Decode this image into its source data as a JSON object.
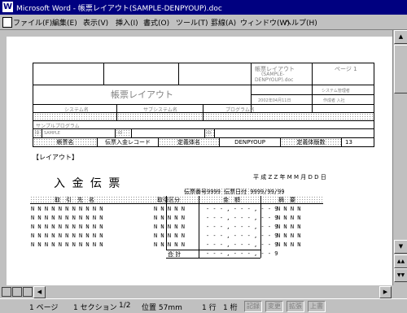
{
  "window": {
    "title": "Microsoft Word - 帳票レイアウト(SAMPLE-DENPYOUP).doc"
  },
  "menu": [
    "ファイル(F)",
    "編集(E)",
    "表示(V)",
    "挿入(I)",
    "書式(O)",
    "ツール(T)",
    "罫線(A)",
    "ウィンドウ(W)",
    "ヘルプ(H)"
  ],
  "header": {
    "title_small": "帳票レイアウト",
    "sub1": "(SAMPLE-",
    "sub2": "DENPYOUP).doc",
    "page_label": "ページ 1",
    "big_title": "帳票レイアウト",
    "sys_name": "システム名",
    "subsystem_name": "サブシステム名",
    "program_name": "プログラム名",
    "date_label": "2002年04月11日",
    "creator_label": "システム管理者",
    "author_label": "作成者 入社",
    "sample_program": "サンプルプログラム",
    "id_label": "ID",
    "sample_value": "SAMPLE",
    "id2_label": "ID",
    "id3_label": "ID"
  },
  "namebar": {
    "report_name_label": "帳票名",
    "report_name": "伝票入金レコード",
    "def_name_label": "定義体名",
    "def_name": "DENPYOUP",
    "def_count_label": "定義体版数",
    "def_count": "13"
  },
  "layout_label": "【レイアウト】",
  "slip": {
    "title": "入 金 伝 票",
    "date": "平 成 Z Z 年 M M 月 D D 日",
    "number_line": "伝票番号9999 伝票日付 9999/99/99",
    "col_customer": "取　引　先　名",
    "col_type": "取引区分",
    "col_amount": "金　額",
    "col_note": "摘　要",
    "row_customer": "N N N N N N N N N N N",
    "row_type": "N N N N N",
    "row_amount": "- - - , - - - , - - 9",
    "row_note": "N N N N",
    "total_label": "合 計",
    "total_amount": "- - - , - - - , - - 9"
  },
  "status": {
    "page": "1 ページ",
    "section": "1 セクション",
    "count": "1/2",
    "position": "位置 57mm",
    "line": "1 行",
    "column": "1 桁",
    "indicators": [
      "記録",
      "変更",
      "拡張",
      "上書"
    ]
  }
}
